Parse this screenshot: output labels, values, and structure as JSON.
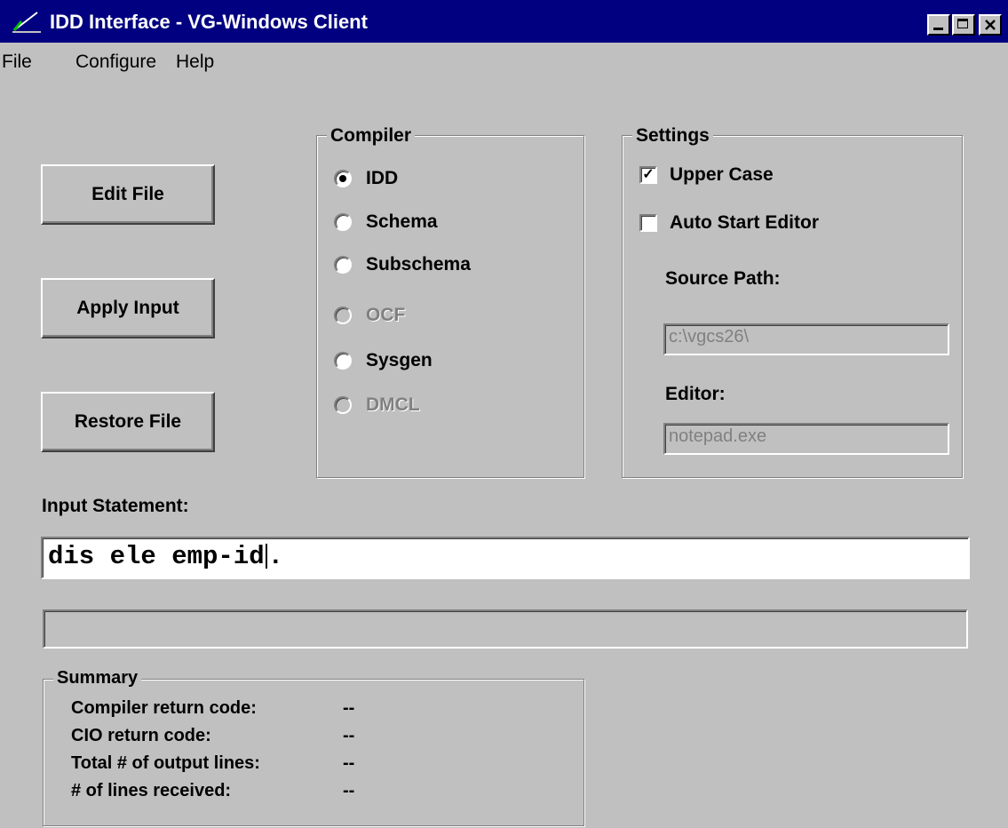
{
  "window": {
    "title": "IDD Interface - VG-Windows Client",
    "controls": {
      "minimize": "_",
      "maximize": "□",
      "close": "×"
    }
  },
  "menu": [
    "File",
    "Configure",
    "Help"
  ],
  "buttons": {
    "edit_file": "Edit File",
    "apply_input": "Apply Input",
    "restore_file": "Restore File"
  },
  "compiler": {
    "legend": "Compiler",
    "options": [
      {
        "label": "IDD",
        "selected": true,
        "enabled": true
      },
      {
        "label": "Schema",
        "selected": false,
        "enabled": true
      },
      {
        "label": "Subschema",
        "selected": false,
        "enabled": true
      },
      {
        "label": "OCF",
        "selected": false,
        "enabled": false
      },
      {
        "label": "Sysgen",
        "selected": false,
        "enabled": true
      },
      {
        "label": "DMCL",
        "selected": false,
        "enabled": false
      }
    ]
  },
  "settings": {
    "legend": "Settings",
    "upper_case": {
      "label": "Upper Case",
      "checked": true
    },
    "auto_start_editor": {
      "label": "Auto Start Editor",
      "checked": false
    },
    "source_path_label": "Source Path:",
    "source_path_value": "c:\\vgcs26\\",
    "editor_label": "Editor:",
    "editor_value": "notepad.exe"
  },
  "input": {
    "label": "Input Statement:",
    "value_before_caret": "dis ele emp-id",
    "value_after_caret": "."
  },
  "status_bar": {
    "text": ""
  },
  "summary": {
    "legend": "Summary",
    "rows": [
      {
        "label": "Compiler return code:",
        "value": "--"
      },
      {
        "label": "CIO return code:",
        "value": "--"
      },
      {
        "label": "Total # of output lines:",
        "value": "--"
      },
      {
        "label": "# of lines received:",
        "value": "--"
      }
    ]
  }
}
